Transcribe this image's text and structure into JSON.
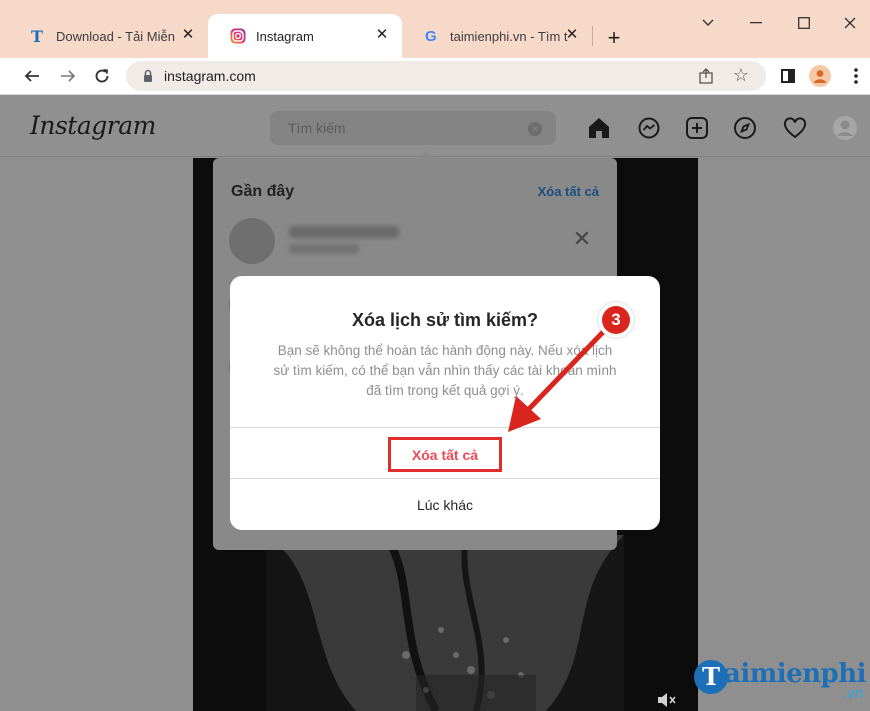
{
  "browser": {
    "tabs": [
      {
        "title": "Download - Tải Miễn",
        "favicon": "taimienphi-t-icon",
        "active": false
      },
      {
        "title": "Instagram",
        "favicon": "instagram-icon",
        "active": true
      },
      {
        "title": "taimienphi.vn - Tìm t",
        "favicon": "google-g-icon",
        "active": false
      }
    ],
    "url": "instagram.com",
    "accent_tabbar": "#f7d9c9"
  },
  "instagram": {
    "logo": "Instagram",
    "search_placeholder": "Tìm kiếm",
    "recent": {
      "title": "Gần đây",
      "clear_all": "Xóa tất cả"
    }
  },
  "modal": {
    "title": "Xóa lịch sử tìm kiếm?",
    "body": "Bạn sẽ không thể hoàn tác hành động này. Nếu xóa lịch sử tìm kiếm, có thể bạn vẫn nhìn thấy các tài khoản mình đã tìm trong kết quả gợi ý.",
    "confirm_label": "Xóa tất cả",
    "cancel_label": "Lúc khác",
    "confirm_color": "#ed4956"
  },
  "annotation": {
    "step": "3",
    "color": "#d9251d"
  },
  "watermark": {
    "brand_initial": "T",
    "brand": "aimienphi",
    "suffix": ".vn"
  }
}
